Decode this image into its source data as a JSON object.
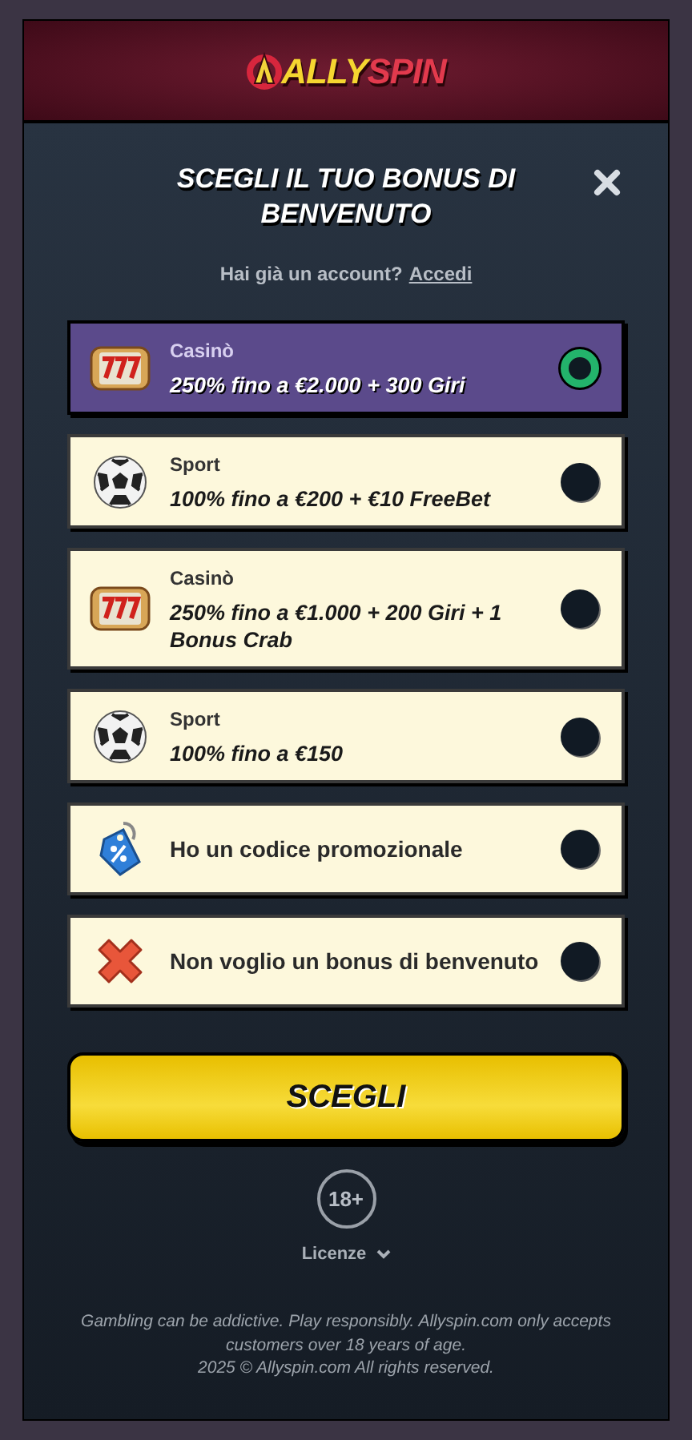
{
  "logo": {
    "part_1": "ALLY",
    "part_2": "SPIN"
  },
  "title": "SCEGLI IL TUO BONUS DI BENVENUTO",
  "login_prompt": {
    "text": "Hai già un account?",
    "link": "Accedi"
  },
  "options": [
    {
      "kind": "slots",
      "category": "Casinò",
      "offer": "250% fino a €2.000 + 300 Giri",
      "selected": true
    },
    {
      "kind": "ball",
      "category": "Sport",
      "offer": "100% fino a €200 + €10 FreeBet",
      "selected": false
    },
    {
      "kind": "slots",
      "category": "Casinò",
      "offer": "250% fino a €1.000 + 200 Giri + 1 Bonus Crab",
      "selected": false
    },
    {
      "kind": "ball",
      "category": "Sport",
      "offer": "100% fino a €150",
      "selected": false
    },
    {
      "kind": "tag",
      "offer": "Ho un codice promozionale",
      "selected": false
    },
    {
      "kind": "cross",
      "offer": "Non voglio un bonus di benvenuto",
      "selected": false
    }
  ],
  "submit_button": "SCEGLI",
  "age_badge": "18+",
  "licenses_toggle": "Licenze",
  "disclaimer": "Gambling can be addictive. Play responsibly. Allyspin.com only accepts customers over 18 years of age.",
  "copyright": "2025 © Allyspin.com All rights reserved."
}
